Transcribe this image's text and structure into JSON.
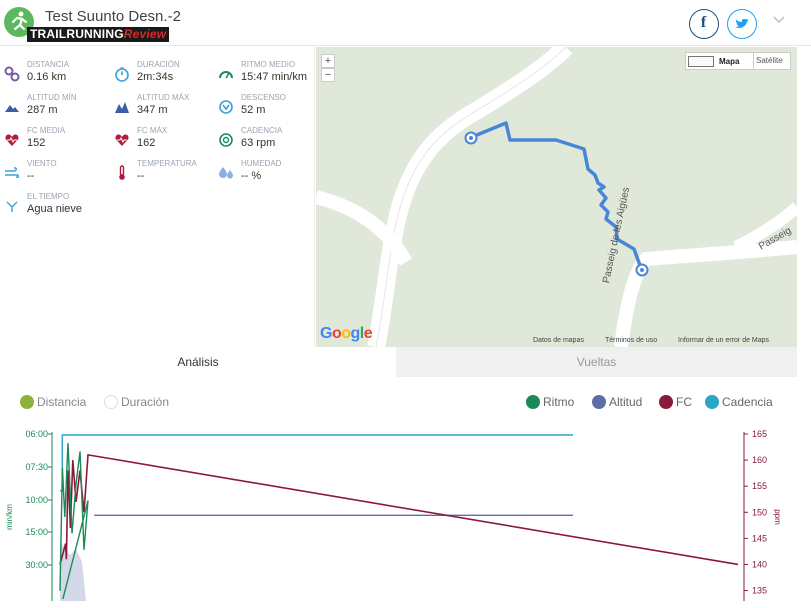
{
  "header": {
    "title": "Test Suunto Desn.-2",
    "logo_main": "TRAILRUNNING",
    "logo_accent": "Review"
  },
  "stats": [
    {
      "icon": "distance-icon",
      "label": "DISTANCIA",
      "value": "0.16 km"
    },
    {
      "icon": "stopwatch-icon",
      "label": "DURACIÓN",
      "value": "2m:34s"
    },
    {
      "icon": "pace-gauge-icon",
      "label": "RITMO MEDIO",
      "value": "15:47 min/km"
    },
    {
      "icon": "mountain-low-icon",
      "label": "ALTITUD MÍN",
      "value": "287 m"
    },
    {
      "icon": "mountain-high-icon",
      "label": "ALTITUD MÁX",
      "value": "347 m"
    },
    {
      "icon": "descent-icon",
      "label": "DESCENSO",
      "value": "52 m"
    },
    {
      "icon": "heart-icon",
      "label": "FC MEDIA",
      "value": "152"
    },
    {
      "icon": "heart-pulse-icon",
      "label": "FC MÁX",
      "value": "162"
    },
    {
      "icon": "cadence-icon",
      "label": "CADENCIA",
      "value": "63 rpm"
    },
    {
      "icon": "wind-icon",
      "label": "VIENTO",
      "value": "--"
    },
    {
      "icon": "thermometer-icon",
      "label": "TEMPERATURA",
      "value": "--"
    },
    {
      "icon": "humidity-icon",
      "label": "HUMEDAD",
      "value": "-- %"
    },
    {
      "icon": "weather-snow-icon",
      "label": "EL TIEMPO",
      "value": "Agua nieve"
    }
  ],
  "map": {
    "zoom_in": "+",
    "zoom_out": "−",
    "type_map": "Mapa",
    "type_satellite": "Satélite",
    "street_1": "Passeig de les Aigües",
    "street_2": "Passeig",
    "google": [
      "G",
      "o",
      "o",
      "g",
      "l",
      "e"
    ],
    "footer": [
      "Datos de mapas",
      "Términos de uso",
      "Informar de un error de Maps"
    ],
    "route_color": "#4a86d8"
  },
  "tabs": [
    "Análisis",
    "Vueltas"
  ],
  "analysis": {
    "x_options": [
      {
        "label": "Distancia",
        "checked": true
      },
      {
        "label": "Duración",
        "checked": false
      }
    ],
    "series_toggles": [
      {
        "label": "Ritmo",
        "color": "#1a8a57"
      },
      {
        "label": "Altitud",
        "color": "#5b6fa6"
      },
      {
        "label": "FC",
        "color": "#8b1a3a"
      },
      {
        "label": "Cadencia",
        "color": "#2aa6c4"
      }
    ]
  },
  "chart_data": {
    "type": "line",
    "left_axis": {
      "label": "min/km",
      "ticks": [
        "06:00",
        "07:30",
        "10:00",
        "15:00",
        "30:00"
      ],
      "color": "#1a8a57"
    },
    "right_axis": {
      "label": "ppm",
      "ticks": [
        165,
        160,
        155,
        150,
        145,
        140,
        135
      ],
      "range": [
        133,
        165
      ],
      "color": "#8b1a3a"
    },
    "x_range": [
      0,
      1
    ],
    "series": [
      {
        "name": "Cadencia",
        "color": "#2aa6c4",
        "x": [
          0,
          0.0033,
          0.0033,
          0.75
        ],
        "y": [
          0.66,
          0.66,
          1.0,
          1.0
        ]
      },
      {
        "name": "Altitud",
        "color": "#5b6fa6",
        "x": [
          0.05,
          0.75
        ],
        "y": [
          0.51,
          0.51
        ]
      },
      {
        "name": "FC",
        "color": "#8b1a3a",
        "x": [
          0.0,
          0.07,
          0.08,
          0.1,
          0.13,
          0.16,
          0.2,
          0.25,
          0.3,
          0.35,
          1.0
        ],
        "y": [
          140,
          144,
          141,
          158,
          147,
          160,
          152,
          158,
          150,
          161,
          140
        ]
      },
      {
        "name": "Ritmo",
        "color": "#1a8a57",
        "x": [
          0.0,
          0.03,
          0.06,
          0.1,
          0.15,
          0.2,
          0.25,
          0.3,
          0.35,
          0.036
        ],
        "y": [
          0.05,
          0.8,
          0.5,
          0.95,
          0.4,
          0.7,
          0.9,
          0.3,
          0.6,
          0.0
        ]
      }
    ]
  }
}
